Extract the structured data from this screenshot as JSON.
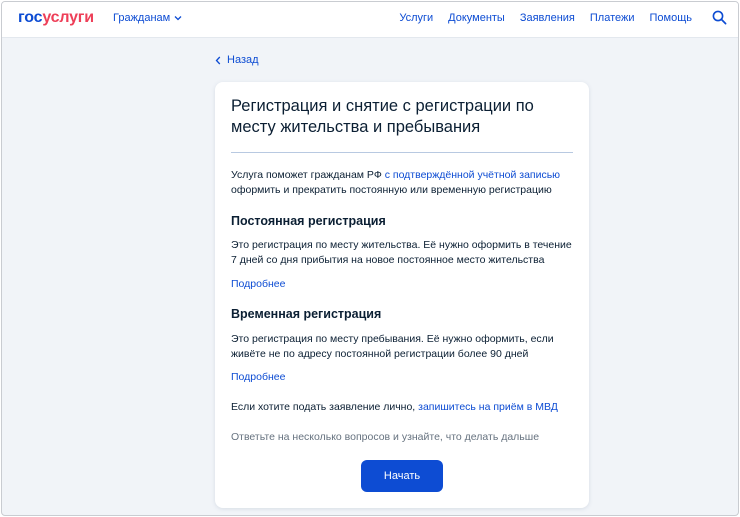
{
  "header": {
    "logo_part1": "гос",
    "logo_part2": "услуги",
    "citizens_label": "Гражданам",
    "nav": [
      "Услуги",
      "Документы",
      "Заявления",
      "Платежи",
      "Помощь"
    ],
    "icons": [
      "chevron-down-icon",
      "search-icon"
    ]
  },
  "back": {
    "label": "Назад",
    "icon": "chevron-left-icon"
  },
  "card": {
    "title": "Регистрация и снятие с регистрации по месту жительства и пребывания",
    "intro_text_1": "Услуга поможет гражданам РФ ",
    "intro_link": "с подтверждённой учётной записью",
    "intro_text_2": "оформить и прекратить постоянную или временную регистрацию",
    "permanent": {
      "heading": "Постоянная регистрация",
      "text": "Это регистрация по месту жительства. Её нужно оформить в течение 7 дней со дня прибытия на новое постоянное место жительства",
      "more": "Подробнее"
    },
    "temporary": {
      "heading": "Временная регистрация",
      "text": "Это регистрация по месту пребывания. Её нужно оформить, если живёте не по адресу постоянной регистрации более 90 дней",
      "more": "Подробнее"
    },
    "in_person_text": "Если хотите подать заявление лично, ",
    "in_person_link": "запишитесь на приём в МВД",
    "hint": "Ответьте на несколько вопросов и узнайте, что делать дальше",
    "start_button": "Начать"
  },
  "colors": {
    "accent": "#0d4cd3",
    "logo_red": "#ee3f58",
    "text": "#0b1f33",
    "muted": "#66727f",
    "page_bg": "#f1f4f8"
  }
}
